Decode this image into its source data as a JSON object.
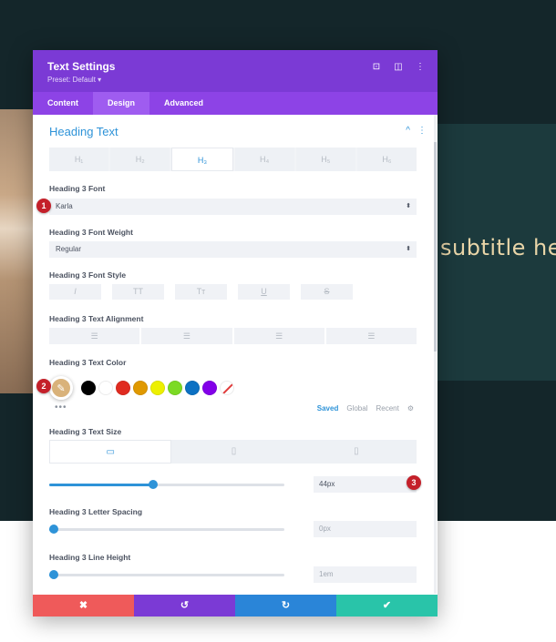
{
  "background": {
    "subtitle": "subtitle he"
  },
  "modal": {
    "title": "Text Settings",
    "preset": "Preset: Default ▾",
    "header_icons": {
      "focus": "⊡",
      "split": "◫",
      "more": "⋮"
    }
  },
  "tabs": [
    {
      "label": "Content"
    },
    {
      "label": "Design"
    },
    {
      "label": "Advanced"
    }
  ],
  "section": {
    "title": "Heading Text",
    "collapse_icon": "^",
    "more_icon": "⋮"
  },
  "heading_tabs": [
    {
      "label": "H₁"
    },
    {
      "label": "H₂"
    },
    {
      "label": "H₃"
    },
    {
      "label": "H₄"
    },
    {
      "label": "H₅"
    },
    {
      "label": "H₆"
    }
  ],
  "font": {
    "label": "Heading 3 Font",
    "value": "Karla",
    "arrow": "⬍"
  },
  "weight": {
    "label": "Heading 3 Font Weight",
    "value": "Regular",
    "arrow": "⬍"
  },
  "style": {
    "label": "Heading 3 Font Style",
    "buttons": [
      {
        "glyph": "I"
      },
      {
        "glyph": "TT"
      },
      {
        "glyph": "Tт"
      },
      {
        "glyph": "U"
      },
      {
        "glyph": "S"
      }
    ]
  },
  "alignment": {
    "label": "Heading 3 Text Alignment",
    "buttons": [
      {
        "glyph": "☰"
      },
      {
        "glyph": "☰"
      },
      {
        "glyph": "☰"
      },
      {
        "glyph": "☰"
      }
    ]
  },
  "color": {
    "label": "Heading 3 Text Color",
    "picker_color": "#d9b27a",
    "picker_icon": "✎",
    "swatches": [
      "#000000",
      "#ffffff",
      "#e02b20",
      "#e09900",
      "#edf000",
      "#7cda24",
      "#0c71c3",
      "#8300e9"
    ],
    "more": "•••",
    "palette_tabs": [
      {
        "label": "Saved"
      },
      {
        "label": "Global"
      },
      {
        "label": "Recent"
      }
    ],
    "settings_icon": "⚙"
  },
  "text_size": {
    "label": "Heading 3 Text Size",
    "device_icons": {
      "desktop": "▭",
      "tablet": "▯",
      "phone": "▯"
    },
    "value": "44px",
    "slider_pct": 44
  },
  "letter_spacing": {
    "label": "Heading 3 Letter Spacing",
    "value": "0px",
    "slider_pct": 2
  },
  "line_height": {
    "label": "Heading 3 Line Height",
    "value": "1em",
    "slider_pct": 2
  },
  "badges": {
    "one": "1",
    "two": "2",
    "three": "3"
  },
  "footer": {
    "cancel": "✖",
    "undo": "↺",
    "redo": "↻",
    "save": "✔",
    "colors": {
      "cancel": "#ef5a5a",
      "undo": "#7b3ad5",
      "redo": "#2a85d8",
      "save": "#29c4a9"
    }
  }
}
